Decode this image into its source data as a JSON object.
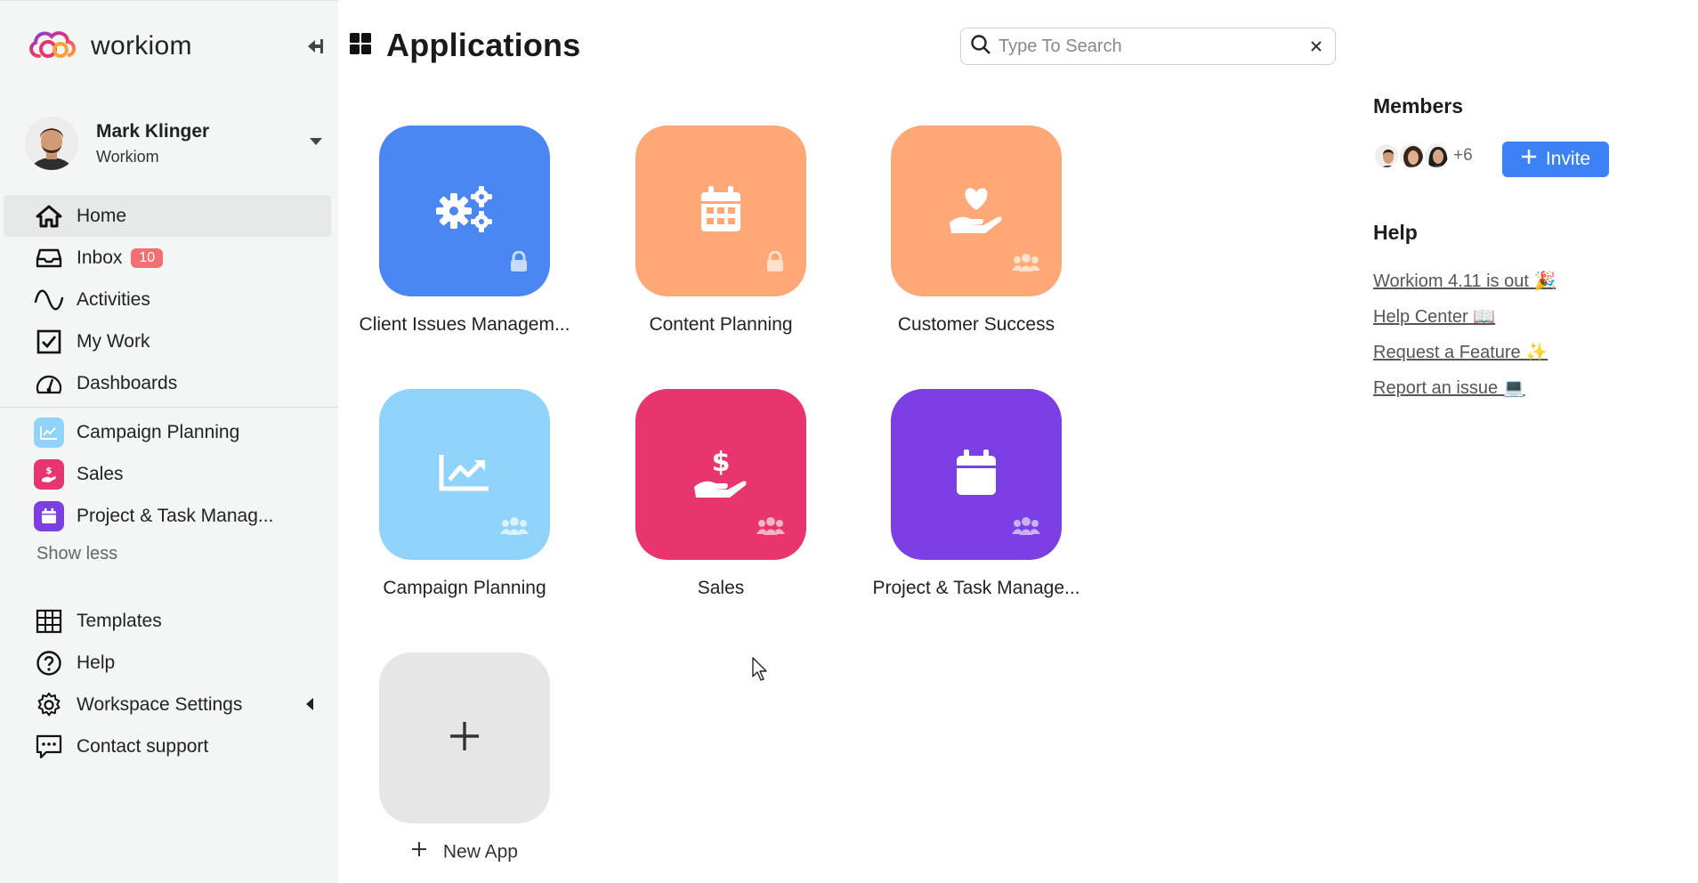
{
  "brand": {
    "name": "workiom"
  },
  "user": {
    "name": "Mark Klinger",
    "org": "Workiom"
  },
  "nav": {
    "items": [
      {
        "label": "Home",
        "icon": "home-icon",
        "active": true
      },
      {
        "label": "Inbox",
        "icon": "inbox-icon",
        "badge": "10"
      },
      {
        "label": "Activities",
        "icon": "activity-wave-icon"
      },
      {
        "label": "My Work",
        "icon": "checkbox-icon"
      },
      {
        "label": "Dashboards",
        "icon": "gauge-icon"
      }
    ],
    "apps": [
      {
        "label": "Campaign Planning",
        "color": "#8fd3fb"
      },
      {
        "label": "Sales",
        "color": "#e8356d"
      },
      {
        "label": "Project & Task Manag...",
        "color": "#7b3fe4"
      }
    ],
    "show_less": "Show less",
    "secondary": [
      {
        "label": "Templates",
        "icon": "grid-table-icon"
      },
      {
        "label": "Help",
        "icon": "question-circle-icon"
      },
      {
        "label": "Workspace Settings",
        "icon": "gear-icon"
      },
      {
        "label": "Contact support",
        "icon": "chat-icon"
      }
    ]
  },
  "header": {
    "title": "Applications",
    "search_placeholder": "Type To Search"
  },
  "apps": [
    {
      "label": "Client Issues Managem...",
      "color": "#4a87f3",
      "icon": "gears-icon",
      "corner": "lock-icon"
    },
    {
      "label": "Content Planning",
      "color": "#fea878",
      "icon": "calendar-icon",
      "corner": "lock-icon"
    },
    {
      "label": "Customer Success",
      "color": "#fea878",
      "icon": "heart-hand-icon",
      "corner": "users-icon"
    },
    {
      "label": "Campaign Planning",
      "color": "#8fd3fb",
      "icon": "chart-trend-icon",
      "corner": "users-icon"
    },
    {
      "label": "Sales",
      "color": "#e8356d",
      "icon": "dollar-hand-icon",
      "corner": "users-icon"
    },
    {
      "label": "Project & Task Manage...",
      "color": "#7b3fe4",
      "icon": "calendar-blank-icon",
      "corner": "users-icon"
    }
  ],
  "new_app": {
    "label": "New App"
  },
  "members": {
    "title": "Members",
    "more": "+6",
    "invite_label": "Invite"
  },
  "help": {
    "title": "Help",
    "links": [
      "Workiom 4.11 is out 🎉",
      "Help Center 📖",
      "Request a Feature ✨",
      "Report an issue 💻"
    ]
  }
}
